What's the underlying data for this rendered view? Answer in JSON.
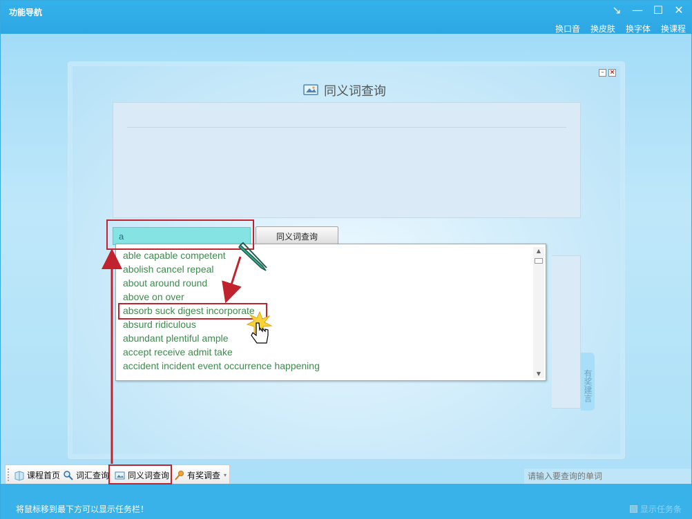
{
  "window": {
    "title": "功能导航",
    "controls": [
      "restore-icon",
      "minimize-icon",
      "maximize-icon",
      "close-icon"
    ],
    "top_links": [
      "换口音",
      "换皮肤",
      "换字体",
      "换课程"
    ]
  },
  "panel": {
    "title": "同义词查询",
    "min_label": "–",
    "close_label": "×"
  },
  "search": {
    "value": "a",
    "button_label": "同义词查询"
  },
  "dropdown": {
    "items": [
      "able capable competent",
      "abolish cancel repeal",
      "about around round",
      "above on over",
      "absorb suck digest incorporate",
      "absurd ridiculous",
      "abundant plentiful ample",
      "accept receive admit take",
      "accident incident event occurrence happening"
    ],
    "highlighted_index": 4
  },
  "side_tab": "有奖建言",
  "taskbar": {
    "items": [
      "课程首页",
      "词汇查询",
      "同义词查询",
      "有奖调查"
    ],
    "active_index": 2
  },
  "bottom": {
    "hint": "将鼠标移到最下方可以显示任务栏！",
    "search_placeholder": "请输入要查询的单词",
    "show_taskbar": "显示任务条"
  },
  "colors": {
    "accent": "#2ea7e4",
    "highlight": "#c0222e",
    "dropdown_text": "#3e8a4d"
  }
}
